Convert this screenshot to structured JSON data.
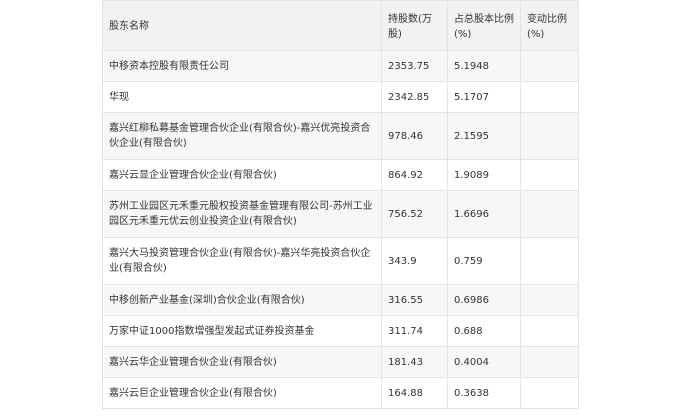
{
  "table": {
    "headers": [
      "股东名称",
      "持股数(万股)",
      "占总股本比例(%)",
      "变动比例(%)"
    ],
    "rows": [
      {
        "name": "中移资本控股有限责任公司",
        "shares": "2353.75",
        "ratio": "5.1948",
        "change": ""
      },
      {
        "name": "华现",
        "shares": "2342.85",
        "ratio": "5.1707",
        "change": ""
      },
      {
        "name": "嘉兴红柳私募基金管理合伙企业(有限合伙)-嘉兴优亮投资合伙企业(有限合伙)",
        "shares": "978.46",
        "ratio": "2.1595",
        "change": ""
      },
      {
        "name": "嘉兴云显企业管理合伙企业(有限合伙)",
        "shares": "864.92",
        "ratio": "1.9089",
        "change": ""
      },
      {
        "name": "苏州工业园区元禾重元股权投资基金管理有限公司-苏州工业园区元禾重元优云创业投资企业(有限合伙)",
        "shares": "756.52",
        "ratio": "1.6696",
        "change": ""
      },
      {
        "name": "嘉兴大马投资管理合伙企业(有限合伙)-嘉兴华亮投资合伙企业(有限合伙)",
        "shares": "343.9",
        "ratio": "0.759",
        "change": ""
      },
      {
        "name": "中移创新产业基金(深圳)合伙企业(有限合伙)",
        "shares": "316.55",
        "ratio": "0.6986",
        "change": ""
      },
      {
        "name": "万家中证1000指数增强型发起式证券投资基金",
        "shares": "311.74",
        "ratio": "0.688",
        "change": ""
      },
      {
        "name": "嘉兴云华企业管理合伙企业(有限合伙)",
        "shares": "181.43",
        "ratio": "0.4004",
        "change": ""
      },
      {
        "name": "嘉兴云巨企业管理合伙企业(有限合伙)",
        "shares": "164.88",
        "ratio": "0.3638",
        "change": ""
      }
    ]
  }
}
